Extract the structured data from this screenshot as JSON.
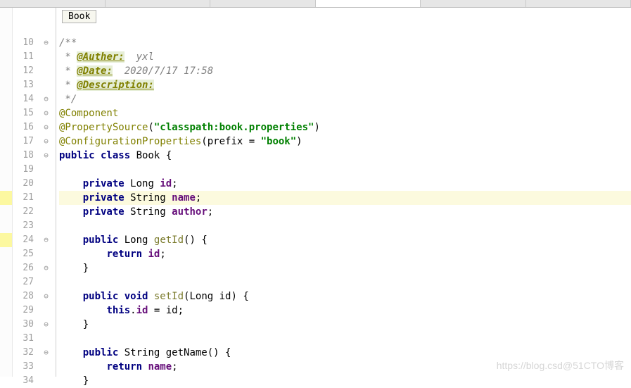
{
  "tooltip": "Book",
  "gutter_start": 10,
  "caret_line_index": 11,
  "yellow_bp_indexes": [
    11,
    14
  ],
  "fold_marks_at": [
    0,
    4,
    5,
    6,
    7,
    8,
    14,
    16,
    18,
    20,
    22
  ],
  "lines": [
    [
      {
        "cls": "c-com",
        "txt": "/**"
      }
    ],
    [
      {
        "cls": "c-com",
        "txt": " * "
      },
      {
        "cls": "c-tag",
        "txt": "@Auther:"
      },
      {
        "cls": "c-com",
        "txt": "  yxl"
      }
    ],
    [
      {
        "cls": "c-com",
        "txt": " * "
      },
      {
        "cls": "c-tag",
        "txt": "@Date:"
      },
      {
        "cls": "c-com",
        "txt": "  2020/7/17 17:58"
      }
    ],
    [
      {
        "cls": "c-com",
        "txt": " * "
      },
      {
        "cls": "c-tag",
        "txt": "@Description:"
      }
    ],
    [
      {
        "cls": "c-com",
        "txt": " */"
      }
    ],
    [
      {
        "cls": "c-ann",
        "txt": "@Component"
      }
    ],
    [
      {
        "cls": "c-ann",
        "txt": "@PropertySource"
      },
      {
        "cls": "",
        "txt": "("
      },
      {
        "cls": "c-str",
        "txt": "\"classpath:book.properties\""
      },
      {
        "cls": "",
        "txt": ")"
      }
    ],
    [
      {
        "cls": "c-ann",
        "txt": "@ConfigurationProperties"
      },
      {
        "cls": "",
        "txt": "(prefix = "
      },
      {
        "cls": "c-str",
        "txt": "\"book\""
      },
      {
        "cls": "",
        "txt": ")"
      }
    ],
    [
      {
        "cls": "c-kw",
        "txt": "public class "
      },
      {
        "cls": "",
        "txt": "Book {"
      }
    ],
    [
      {
        "cls": "",
        "txt": ""
      }
    ],
    [
      {
        "cls": "",
        "txt": "    "
      },
      {
        "cls": "c-kw",
        "txt": "private "
      },
      {
        "cls": "",
        "txt": "Long "
      },
      {
        "cls": "c-fld",
        "txt": "id"
      },
      {
        "cls": "",
        "txt": ";"
      }
    ],
    [
      {
        "cls": "",
        "txt": "    "
      },
      {
        "cls": "c-kw",
        "txt": "private "
      },
      {
        "cls": "",
        "txt": "String "
      },
      {
        "cls": "c-fld",
        "txt": "name"
      },
      {
        "cls": "",
        "txt": ";"
      }
    ],
    [
      {
        "cls": "",
        "txt": "    "
      },
      {
        "cls": "c-kw",
        "txt": "private "
      },
      {
        "cls": "",
        "txt": "String "
      },
      {
        "cls": "c-fld",
        "txt": "author"
      },
      {
        "cls": "",
        "txt": ";"
      }
    ],
    [
      {
        "cls": "",
        "txt": ""
      }
    ],
    [
      {
        "cls": "",
        "txt": "    "
      },
      {
        "cls": "c-kw",
        "txt": "public "
      },
      {
        "cls": "",
        "txt": "Long "
      },
      {
        "cls": "c-mth",
        "txt": "getId"
      },
      {
        "cls": "",
        "txt": "() {"
      }
    ],
    [
      {
        "cls": "",
        "txt": "        "
      },
      {
        "cls": "c-kw",
        "txt": "return "
      },
      {
        "cls": "c-fld",
        "txt": "id"
      },
      {
        "cls": "",
        "txt": ";"
      }
    ],
    [
      {
        "cls": "",
        "txt": "    }"
      }
    ],
    [
      {
        "cls": "",
        "txt": ""
      }
    ],
    [
      {
        "cls": "",
        "txt": "    "
      },
      {
        "cls": "c-kw",
        "txt": "public void "
      },
      {
        "cls": "c-mth",
        "txt": "setId"
      },
      {
        "cls": "",
        "txt": "(Long id) {"
      }
    ],
    [
      {
        "cls": "",
        "txt": "        "
      },
      {
        "cls": "c-kw",
        "txt": "this"
      },
      {
        "cls": "",
        "txt": "."
      },
      {
        "cls": "c-fld",
        "txt": "id"
      },
      {
        "cls": "",
        "txt": " = id;"
      }
    ],
    [
      {
        "cls": "",
        "txt": "    }"
      }
    ],
    [
      {
        "cls": "",
        "txt": ""
      }
    ],
    [
      {
        "cls": "",
        "txt": "    "
      },
      {
        "cls": "c-kw",
        "txt": "public "
      },
      {
        "cls": "",
        "txt": "String getName() {"
      }
    ],
    [
      {
        "cls": "",
        "txt": "        "
      },
      {
        "cls": "c-kw",
        "txt": "return "
      },
      {
        "cls": "c-fld",
        "txt": "name"
      },
      {
        "cls": "",
        "txt": ";"
      }
    ],
    [
      {
        "cls": "",
        "txt": "    }"
      }
    ]
  ],
  "watermark_left": "https://blog.csd",
  "watermark_right": "@51CTO博客"
}
